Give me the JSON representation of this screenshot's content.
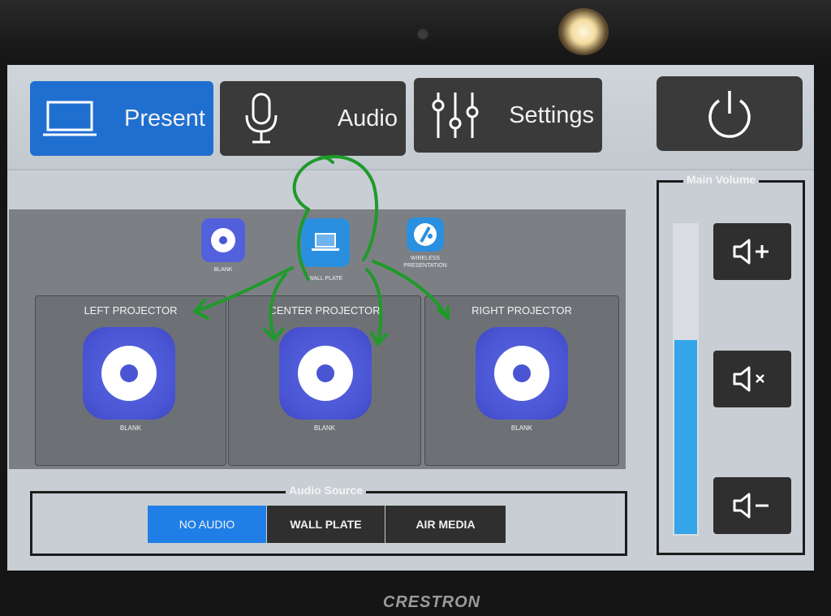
{
  "device": {
    "brand": "CRESTRON"
  },
  "tabs": [
    {
      "label": "Present",
      "icon": "laptop-icon",
      "active": true
    },
    {
      "label": "Audio",
      "icon": "microphone-icon",
      "active": false
    },
    {
      "label": "Settings",
      "icon": "sliders-icon",
      "active": false
    }
  ],
  "power": {
    "icon": "power-icon"
  },
  "sources": [
    {
      "label": "BLANK",
      "icon": "blank-disc-icon"
    },
    {
      "label": "WALL PLATE",
      "icon": "laptop-icon"
    },
    {
      "label": "WIRELESS PRESENTATION",
      "icon": "airmedia-icon"
    }
  ],
  "projectors": [
    {
      "title": "LEFT PROJECTOR",
      "source": "BLANK"
    },
    {
      "title": "CENTER PROJECTOR",
      "source": "BLANK"
    },
    {
      "title": "RIGHT PROJECTOR",
      "source": "BLANK"
    }
  ],
  "audio_source": {
    "title": "Audio Source",
    "options": [
      {
        "label": "NO AUDIO",
        "active": true
      },
      {
        "label": "WALL PLATE",
        "active": false
      },
      {
        "label": "AIR MEDIA",
        "active": false
      }
    ]
  },
  "volume": {
    "title": "Main Volume",
    "level": 0.62,
    "buttons": [
      "volume-up-icon",
      "mute-icon",
      "volume-down-icon"
    ]
  },
  "colors": {
    "accent": "#1f6fd1",
    "volume_fill": "#35a6ea",
    "button_dark": "#3a3a3a",
    "annotation": "#1f9a2a"
  }
}
